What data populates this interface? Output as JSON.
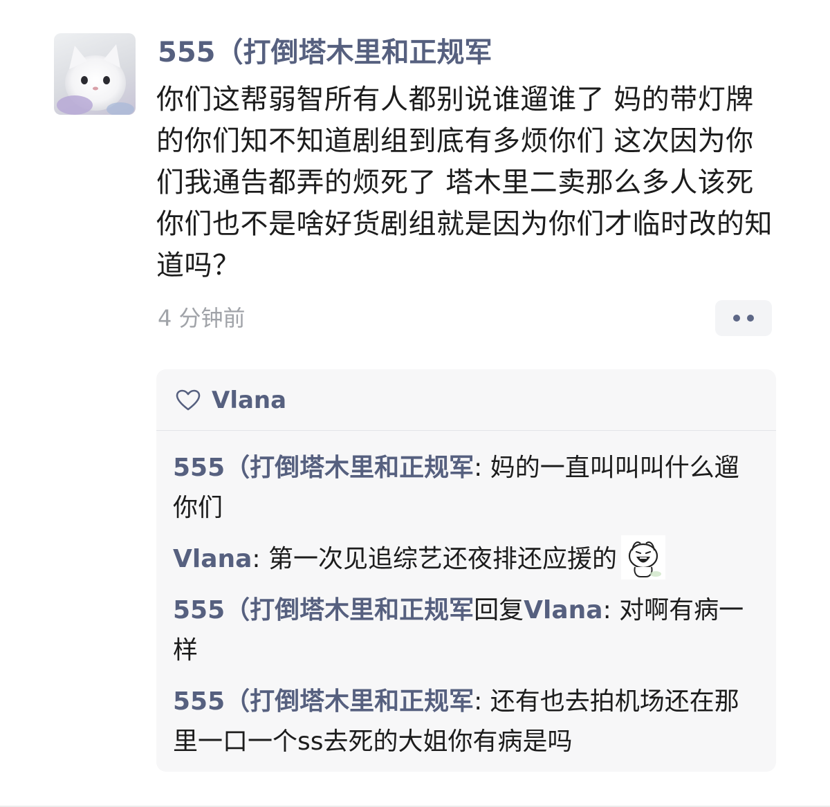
{
  "comment": {
    "username": "555（打倒塔木里和正规军",
    "body": "你们这帮弱智所有人都别说谁遛谁了 妈的带灯牌的你们知不知道剧组到底有多烦你们 这次因为你们我通告都弄的烦死了 塔木里二卖那么多人该死你们也不是啥好货剧组就是因为你们才临时改的知道吗？",
    "timestamp": "4 分钟前"
  },
  "likes": {
    "icon": "heart-outline-icon",
    "liker": "Vlana"
  },
  "replies": [
    {
      "author": "555（打倒塔木里和正规军",
      "separator": ": ",
      "text": "妈的一直叫叫叫什么遛你们"
    },
    {
      "author": "Vlana",
      "separator": ": ",
      "text": "第一次见追综艺还夜排还应援的",
      "sticker": "laughing-cartoon-sticker"
    },
    {
      "author": "555（打倒塔木里和正规军",
      "reply_word": "回复",
      "target": "Vlana",
      "separator": ": ",
      "text": "对啊有病一样"
    },
    {
      "author": "555（打倒塔木里和正规军",
      "separator": ": ",
      "text": "还有也去拍机场还在那里一口一个ss去死的大姐你有病是吗"
    }
  ],
  "colors": {
    "name_accent": "#56607f",
    "body_text": "#1c1c1c",
    "muted": "#a0a3a8",
    "panel_bg": "#f7f7f8"
  }
}
